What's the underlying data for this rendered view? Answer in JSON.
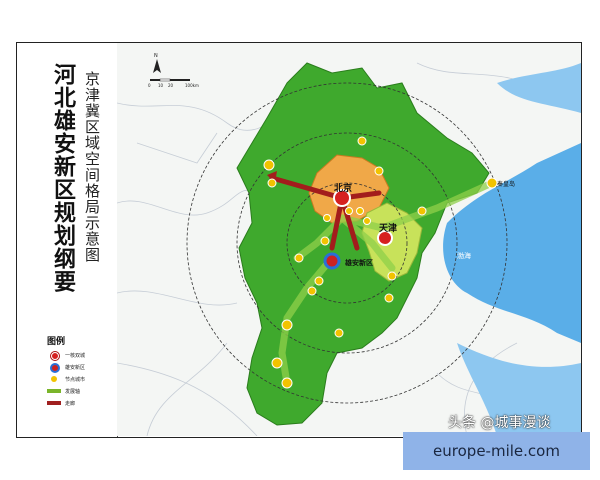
{
  "title": {
    "main": "河北雄安新区规划纲要",
    "sub": "京津冀区域空间格局示意图"
  },
  "scale_bar": {
    "ticks": [
      "0",
      "10",
      "20",
      "100km"
    ]
  },
  "legend": {
    "title": "图例",
    "items": [
      {
        "symbol": "circle-red",
        "label": "一核双城"
      },
      {
        "symbol": "circle-blue",
        "label": "雄安新区"
      },
      {
        "symbol": "circle-yellow",
        "label": "节点城市"
      },
      {
        "symbol": "axis",
        "label": "发展轴"
      },
      {
        "symbol": "corridor",
        "label": "走廊"
      }
    ]
  },
  "places": {
    "beijing": "北京",
    "tianjin": "天津",
    "xiongan": "雄安新区",
    "bohai": "渤海",
    "qinhuangdao": "秦皇岛"
  },
  "watermark": "头条 @城事漫谈",
  "url_banner": "europe-mile.com",
  "colors": {
    "hebei_green": "#3fa92d",
    "beijing_orange": "#f0a848",
    "tianjin_yellowgreen": "#c8e25a",
    "sea_blue": "#5aaee8",
    "corridor_red": "#a31c1c",
    "node_yellow": "#f2c300"
  }
}
